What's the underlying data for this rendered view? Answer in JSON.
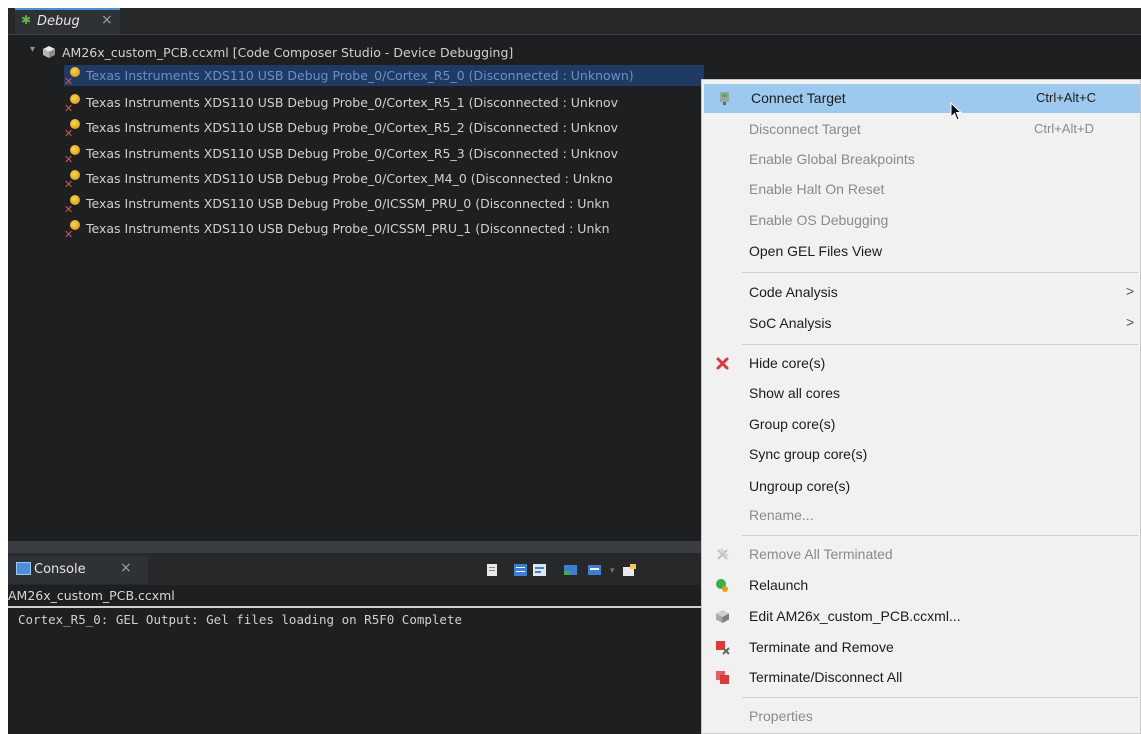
{
  "debug_tab": {
    "label": "Debug",
    "close": "×"
  },
  "tree": {
    "root": "AM26x_custom_PCB.ccxml [Code Composer Studio - Device Debugging]",
    "cores": [
      "Texas Instruments XDS110 USB Debug Probe_0/Cortex_R5_0 (Disconnected : Unknown)",
      "Texas Instruments XDS110 USB Debug Probe_0/Cortex_R5_1 (Disconnected : Unknov",
      "Texas Instruments XDS110 USB Debug Probe_0/Cortex_R5_2 (Disconnected : Unknov",
      "Texas Instruments XDS110 USB Debug Probe_0/Cortex_R5_3 (Disconnected : Unknov",
      "Texas Instruments XDS110 USB Debug Probe_0/Cortex_M4_0 (Disconnected : Unkno",
      "Texas Instruments XDS110 USB Debug Probe_0/ICSSM_PRU_0 (Disconnected : Unkn",
      "Texas Instruments XDS110 USB Debug Probe_0/ICSSM_PRU_1 (Disconnected : Unkn"
    ]
  },
  "console": {
    "tab_label": "Console",
    "close": "×",
    "title": "AM26x_custom_PCB.ccxml",
    "line": "Cortex_R5_0: GEL Output: Gel files loading on R5F0 Complete"
  },
  "menu": {
    "connect_target": {
      "label": "Connect Target",
      "shortcut": "Ctrl+Alt+C"
    },
    "disconnect_target": {
      "label": "Disconnect Target",
      "shortcut": "Ctrl+Alt+D"
    },
    "enable_global_breakpoints": "Enable Global Breakpoints",
    "enable_halt_on_reset": "Enable Halt On Reset",
    "enable_os_debugging": "Enable OS Debugging",
    "open_gel_files_view": "Open GEL Files View",
    "code_analysis": "Code Analysis",
    "soc_analysis": "SoC Analysis",
    "hide_cores": "Hide core(s)",
    "show_all_cores": "Show all cores",
    "group_cores": "Group core(s)",
    "sync_group_cores": "Sync group core(s)",
    "ungroup_cores": "Ungroup core(s)",
    "rename": "Rename...",
    "remove_all_terminated": "Remove All Terminated",
    "relaunch": "Relaunch",
    "edit_ccxml": "Edit AM26x_custom_PCB.ccxml...",
    "terminate_and_remove": "Terminate and Remove",
    "terminate_disconnect_all": "Terminate/Disconnect All",
    "properties": "Properties",
    "submenu_arrow": ">"
  }
}
